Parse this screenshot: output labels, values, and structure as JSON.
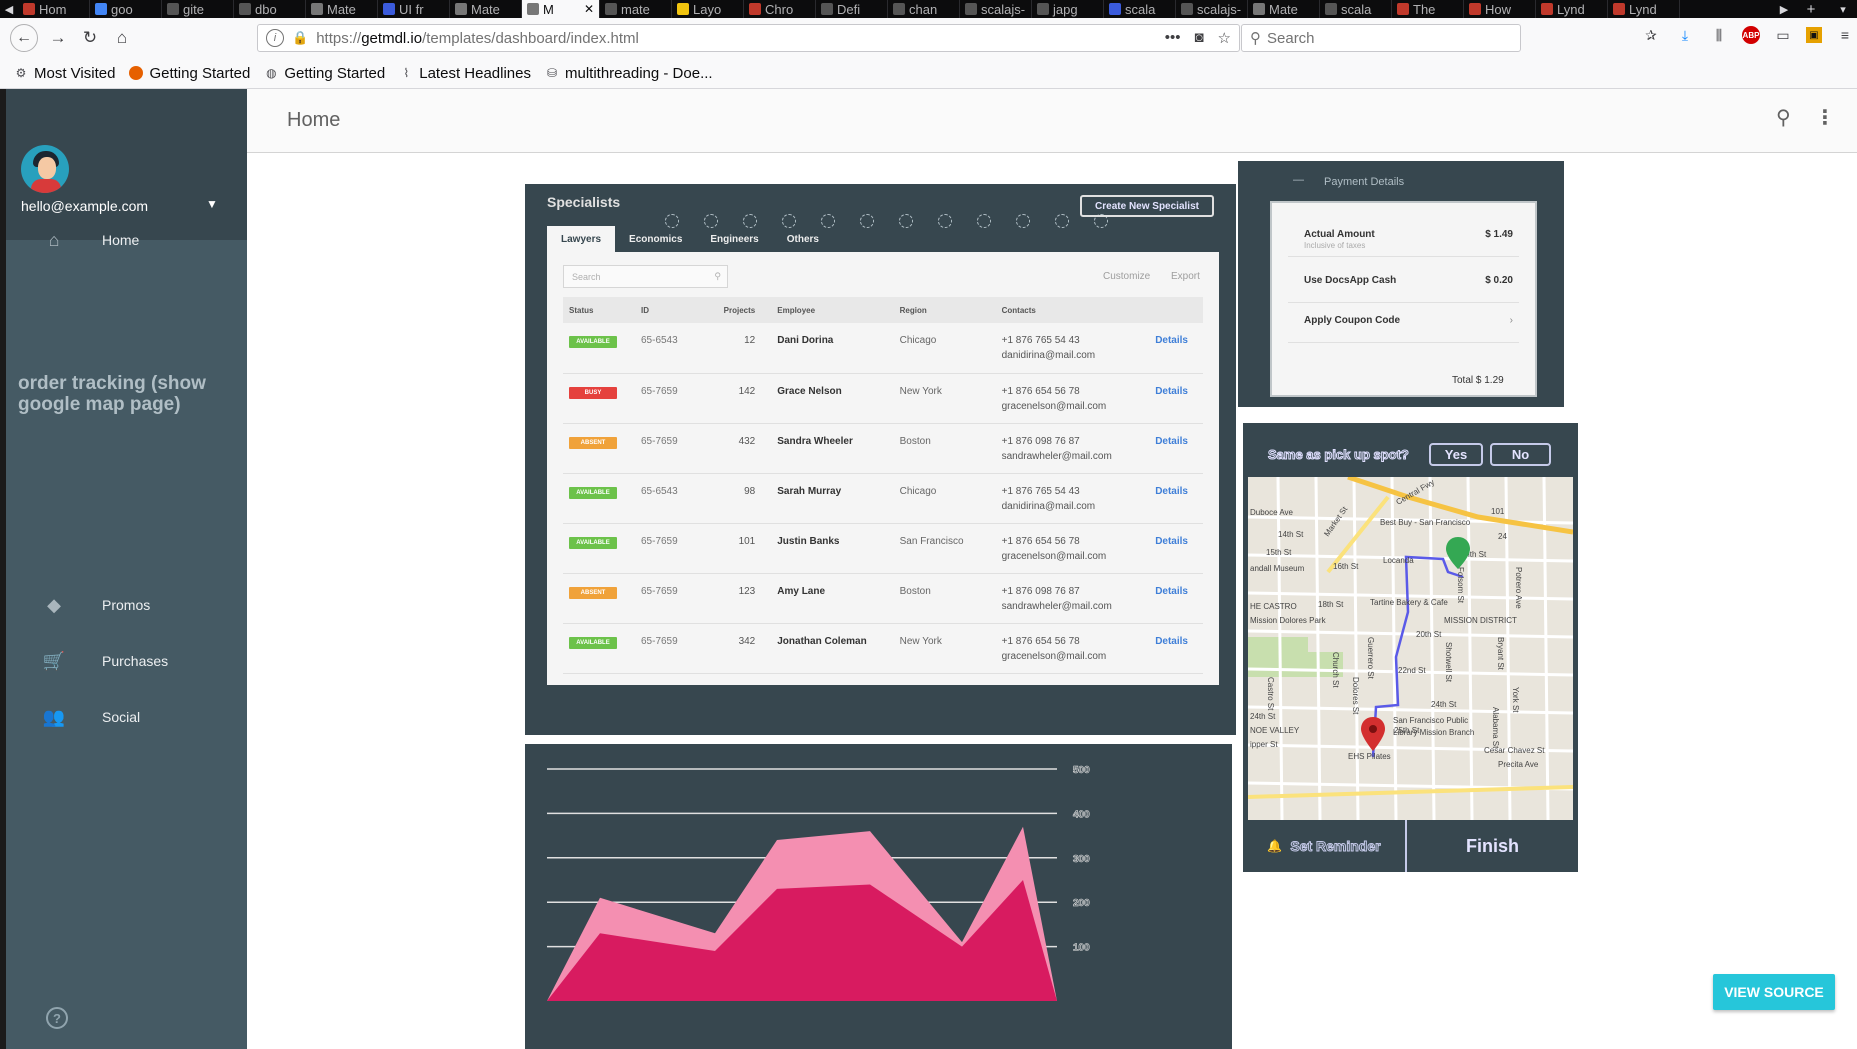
{
  "browser": {
    "tabs": [
      {
        "label": "Hom",
        "color": "#c0392b"
      },
      {
        "label": "goo",
        "color": "#4285f4"
      },
      {
        "label": "gite",
        "color": "#555555"
      },
      {
        "label": "dbo",
        "color": "#555555"
      },
      {
        "label": "Mate",
        "color": "#777777"
      },
      {
        "label": "UI fr",
        "color": "#3b5bdb"
      },
      {
        "label": "Mate",
        "color": "#777777"
      },
      {
        "label": "M",
        "color": "#777777",
        "active": true
      },
      {
        "label": "mate",
        "color": "#555555"
      },
      {
        "label": "Layo",
        "color": "#f1c40f"
      },
      {
        "label": "Chro",
        "color": "#c0392b"
      },
      {
        "label": "Defi",
        "color": "#555555"
      },
      {
        "label": "chan",
        "color": "#555555"
      },
      {
        "label": "scalajs-",
        "color": "#555555"
      },
      {
        "label": "japg",
        "color": "#555555"
      },
      {
        "label": "scala",
        "color": "#3b5bdb"
      },
      {
        "label": "scalajs-",
        "color": "#555555"
      },
      {
        "label": "Mate",
        "color": "#777777"
      },
      {
        "label": "scala",
        "color": "#555555"
      },
      {
        "label": "The",
        "color": "#c0392b"
      },
      {
        "label": "How",
        "color": "#c0392b"
      },
      {
        "label": "Lynd",
        "color": "#c0392b"
      },
      {
        "label": "Lynd",
        "color": "#c0392b"
      }
    ],
    "url_prefix": "https://",
    "url_domain": "getmdl.io",
    "url_path": "/templates/dashboard/index.html",
    "search_placeholder": "Search",
    "abp_label": "ABP",
    "bookmarks": [
      {
        "icon": "gear-icon",
        "label": "Most Visited"
      },
      {
        "icon": "firefox-icon",
        "label": "Getting Started"
      },
      {
        "icon": "globe-icon",
        "label": "Getting Started"
      },
      {
        "icon": "rss-icon",
        "label": "Latest Headlines"
      },
      {
        "icon": "stackoverflow-icon",
        "label": "multithreading - Doe..."
      }
    ]
  },
  "drawer": {
    "email": "hello@example.com",
    "nav": [
      {
        "icon": "home-icon",
        "label": "Home"
      },
      {
        "icon": "tag-icon",
        "label": "Promos"
      },
      {
        "icon": "cart-icon",
        "label": "Purchases"
      },
      {
        "icon": "people-icon",
        "label": "Social"
      }
    ],
    "order_tracking": "order tracking (show google map page)"
  },
  "header": {
    "title": "Home"
  },
  "specialists": {
    "title": "Specialists",
    "create_button": "Create New Specialist",
    "tabs": [
      "Lawyers",
      "Economics",
      "Engineers",
      "Others"
    ],
    "search_placeholder": "Search",
    "customize": "Customize",
    "export": "Export",
    "columns": [
      "Status",
      "ID",
      "Projects",
      "Employee",
      "Region",
      "Contacts",
      ""
    ],
    "rows": [
      {
        "status": "AVAILABLE",
        "status_type": "available",
        "id": "65-6543",
        "projects": "12",
        "employee": "Dani Dorina",
        "region": "Chicago",
        "phone": "+1 876 765 54 43",
        "email": "danidirina@mail.com",
        "action": "Details"
      },
      {
        "status": "BUSY",
        "status_type": "busy",
        "id": "65-7659",
        "projects": "142",
        "employee": "Grace Nelson",
        "region": "New York",
        "phone": "+1 876 654 56 78",
        "email": "gracenelson@mail.com",
        "action": "Details"
      },
      {
        "status": "ABSENT",
        "status_type": "absent",
        "id": "65-7659",
        "projects": "432",
        "employee": "Sandra Wheeler",
        "region": "Boston",
        "phone": "+1 876 098 76 87",
        "email": "sandrawheler@mail.com",
        "action": "Details"
      },
      {
        "status": "AVAILABLE",
        "status_type": "available",
        "id": "65-6543",
        "projects": "98",
        "employee": "Sarah Murray",
        "region": "Chicago",
        "phone": "+1 876 765 54 43",
        "email": "danidirina@mail.com",
        "action": "Details"
      },
      {
        "status": "AVAILABLE",
        "status_type": "available",
        "id": "65-7659",
        "projects": "101",
        "employee": "Justin Banks",
        "region": "San Francisco",
        "phone": "+1 876 654 56 78",
        "email": "gracenelson@mail.com",
        "action": "Details"
      },
      {
        "status": "ABSENT",
        "status_type": "absent",
        "id": "65-7659",
        "projects": "123",
        "employee": "Amy Lane",
        "region": "Boston",
        "phone": "+1 876 098 76 87",
        "email": "sandrawheler@mail.com",
        "action": "Details"
      },
      {
        "status": "AVAILABLE",
        "status_type": "available",
        "id": "65-7659",
        "projects": "342",
        "employee": "Jonathan Coleman",
        "region": "New York",
        "phone": "+1 876 654 56 78",
        "email": "gracenelson@mail.com",
        "action": "Details"
      }
    ]
  },
  "payment": {
    "title": "Payment Details",
    "rows": [
      {
        "label": "Actual Amount",
        "sub": "Inclusive of taxes",
        "value": "$ 1.49"
      },
      {
        "label": "Use DocsApp Cash",
        "sub": "",
        "value": "$ 0.20"
      },
      {
        "label": "Apply Coupon Code",
        "sub": "",
        "value": "›"
      }
    ],
    "total": "Total  $ 1.29"
  },
  "map": {
    "question": "Same as pick up spot?",
    "yes": "Yes",
    "no": "No",
    "reminder": "Set Reminder",
    "finish": "Finish",
    "labels": [
      {
        "text": "Central Fwy"
      },
      {
        "text": "Best Buy - San Francisco"
      },
      {
        "text": "Market St"
      },
      {
        "text": "Duboce Ave"
      },
      {
        "text": "14th St"
      },
      {
        "text": "15th St"
      },
      {
        "text": "16th St"
      },
      {
        "text": "Locanda"
      },
      {
        "text": "andall Museum"
      },
      {
        "text": "Tartine Bakery & Cafe"
      },
      {
        "text": "18th St"
      },
      {
        "text": "HE CASTRO"
      },
      {
        "text": "Mission Dolores Park"
      },
      {
        "text": "MISSION DISTRICT"
      },
      {
        "text": "20th St"
      },
      {
        "text": "22nd St"
      },
      {
        "text": "24th St"
      },
      {
        "text": "24th St"
      },
      {
        "text": "25th St"
      },
      {
        "text": "NOE VALLEY"
      },
      {
        "text": "San Francisco Public"
      },
      {
        "text": "Library Mission Branch"
      },
      {
        "text": "EHS Pilates"
      },
      {
        "text": "Cesar Chavez St"
      },
      {
        "text": "Dolores St"
      },
      {
        "text": "Church St"
      },
      {
        "text": "Guerrero St"
      },
      {
        "text": "Folsom St"
      },
      {
        "text": "Potrero Ave"
      },
      {
        "text": "Bryant St"
      },
      {
        "text": "York St"
      },
      {
        "text": "Alabama St"
      },
      {
        "text": "Shotwell St"
      },
      {
        "text": "Castro St"
      },
      {
        "text": "Precita Ave"
      },
      {
        "text": "ipper St"
      },
      {
        "text": "ith St"
      },
      {
        "text": "24"
      },
      {
        "text": "101"
      }
    ]
  },
  "chart_data": {
    "type": "area",
    "x": [
      0,
      1,
      2,
      3,
      4,
      5,
      6,
      7,
      8
    ],
    "series": [
      {
        "values": [
          0,
          210,
          130,
          340,
          360,
          110,
          370,
          0,
          0
        ],
        "color": "#f48fb1"
      },
      {
        "values": [
          0,
          130,
          90,
          230,
          240,
          100,
          250,
          0,
          0
        ],
        "color": "#d81b60"
      }
    ],
    "y_ticks": [
      "500",
      "400",
      "300",
      "200",
      "100"
    ],
    "ylim": [
      0,
      500
    ],
    "grid": true
  },
  "view_source": "VIEW SOURCE"
}
